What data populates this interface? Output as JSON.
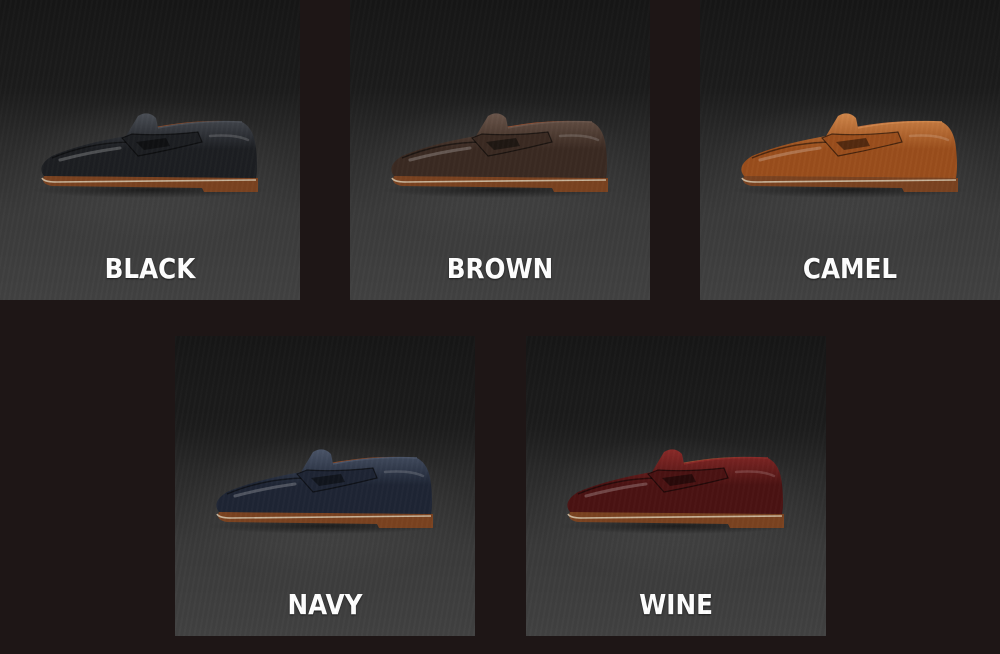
{
  "variants": [
    {
      "label": "BLACK",
      "color": "#1c1e22",
      "highlight": "#4a4e55",
      "lining": "#8a4a2a"
    },
    {
      "label": "BROWN",
      "color": "#3a2a22",
      "highlight": "#6a554a",
      "lining": "#9a5030"
    },
    {
      "label": "CAMEL",
      "color": "#9a4e1c",
      "highlight": "#d0864a",
      "lining": "#c07040"
    },
    {
      "label": "NAVY",
      "color": "#1e2534",
      "highlight": "#4a5468",
      "lining": "#8a4a2a"
    },
    {
      "label": "WINE",
      "color": "#4a1212",
      "highlight": "#8a2a28",
      "lining": "#9a4a30"
    }
  ],
  "sole_color": "#7a4220",
  "welt_color": "#c8b49a"
}
